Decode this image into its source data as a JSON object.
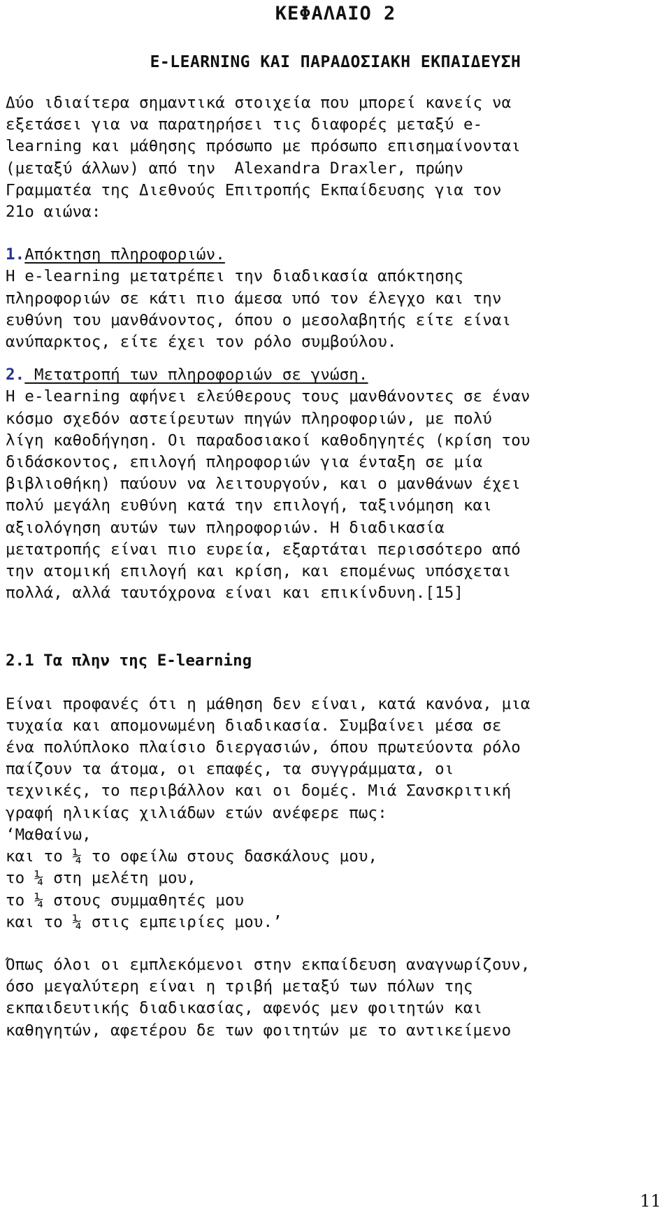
{
  "document": {
    "chapter_title": "ΚΕΦΑΛΑΙΟ 2",
    "chapter_subtitle": "E-LEARNING ΚΑΙ ΠΑΡΑΔΟΣΙΑΚΗ ΕΚΠΑΙΔΕΥΣΗ",
    "page_number": "11",
    "marker_color": "#26348c",
    "text_color": "#111111",
    "background_color": "#ffffff"
  },
  "intro_paragraph": {
    "lines": [
      "Δύο ιδιαίτερα σημαντικά στοιχεία που μπορεί κανείς να",
      "εξετάσει για να παρατηρήσει τις διαφορές μεταξύ e-",
      "learning και μάθησης πρόσωπο με πρόσωπο επισημαίνονται",
      "(μεταξύ άλλων) από την  Alexandra Draxler, πρώην",
      "Γραμματέα της Διεθνούς Επιτροπής Εκπαίδευσης για τον",
      "21ο αιώνα:"
    ]
  },
  "list_items": [
    {
      "marker": "1.",
      "heading": "Απόκτηση πληροφοριών.",
      "body_lines": [
        "Η e-learning μετατρέπει την διαδικασία απόκτησης",
        "πληροφοριών σε κάτι πιο άμεσα υπό τον έλεγχο και την",
        "ευθύνη του μανθάνοντος, όπου ο μεσολαβητής είτε είναι",
        "ανύπαρκτος, είτε έχει τον ρόλο συμβούλου."
      ]
    },
    {
      "marker": "2.",
      "heading": " Μετατροπή των πληροφοριών σε γνώση.",
      "body_lines": [
        "Η e-learning αφήνει ελεύθερους τους μανθάνοντες σε έναν",
        "κόσμο σχεδόν αστείρευτων πηγών πληροφοριών, με πολύ",
        "λίγη καθοδήγηση. Οι παραδοσιακοί καθοδηγητές (κρίση του",
        "διδάσκοντος, επιλογή πληροφοριών για ένταξη σε μία",
        "βιβλιοθήκη) παύουν να λειτουργούν, και ο μανθάνων έχει",
        "πολύ μεγάλη ευθύνη κατά την επιλογή, ταξινόμηση και",
        "αξιολόγηση αυτών των πληροφοριών. Η διαδικασία",
        "μετατροπής είναι πιο ευρεία, εξαρτάται περισσότερο από",
        "την ατομική επιλογή και κρίση, και επομένως υπόσχεται",
        "πολλά, αλλά ταυτόχρονα είναι και επικίνδυνη.[15]"
      ]
    }
  ],
  "section": {
    "heading": "2.1 Τα πλην της E-learning",
    "paragraph_lines": [
      "Είναι προφανές ότι η μάθηση δεν είναι, κατά κανόνα, μια",
      "τυχαία και απομονωμένη διαδικασία. Συμβαίνει μέσα σε",
      "ένα πολύπλοκο πλαίσιο διεργασιών, όπου πρωτεύοντα ρόλο",
      "παίζουν τα άτομα, οι επαφές, τα συγγράμματα, οι",
      "τεχνικές, το περιβάλλον και οι δομές. Μιά Σανσκριτική",
      "γραφή ηλικίας χιλιάδων ετών ανέφερε πως:"
    ],
    "quote_lines": [
      "‘Μαθαίνω,",
      "και το ¼ το οφείλω στους δασκάλους μου,",
      "το ¼ στη μελέτη μου,",
      "το ¼ στους συμμαθητές μου",
      "και το ¼ στις εμπειρίες μου.’"
    ],
    "closing_lines": [
      "Όπως όλοι οι εμπλεκόμενοι στην εκπαίδευση αναγνωρίζουν,",
      "όσο μεγαλύτερη είναι η τριβή μεταξύ των πόλων της",
      "εκπαιδευτικής διαδικασίας, αφενός μεν φοιτητών και",
      "καθηγητών, αφετέρου δε των φοιτητών με το αντικείμενο"
    ]
  }
}
